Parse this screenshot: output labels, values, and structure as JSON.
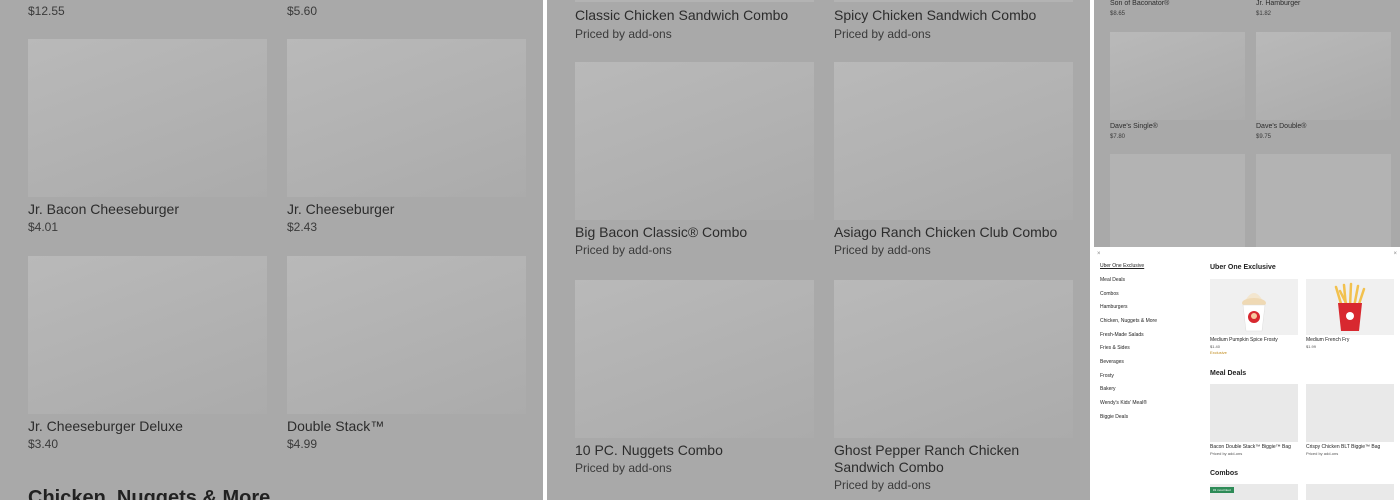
{
  "panel1": {
    "top_prices": [
      "$12.55",
      "$5.60"
    ],
    "items": [
      {
        "name": "Jr. Bacon Cheeseburger",
        "price": "$4.01"
      },
      {
        "name": "Jr. Cheeseburger",
        "price": "$2.43"
      },
      {
        "name": "Jr. Cheeseburger Deluxe",
        "price": "$3.40"
      },
      {
        "name": "Double Stack™",
        "price": "$4.99"
      }
    ],
    "section_title": "Chicken, Nuggets & More"
  },
  "panel2": {
    "top_items": [
      {
        "name": "Classic Chicken Sandwich Combo",
        "price": "Priced by add-ons"
      },
      {
        "name": "Spicy Chicken Sandwich Combo",
        "price": "Priced by add-ons"
      }
    ],
    "items": [
      {
        "name": "Big Bacon Classic® Combo",
        "price": "Priced by add-ons"
      },
      {
        "name": "Asiago Ranch Chicken Club Combo",
        "price": "Priced by add-ons"
      },
      {
        "name": "10 PC. Nuggets Combo",
        "price": "Priced by add-ons"
      },
      {
        "name": "Ghost Pepper Ranch Chicken Sandwich Combo",
        "price": "Priced by add-ons"
      }
    ]
  },
  "panel3": {
    "top_items": [
      {
        "name": "Son of Baconator®",
        "price": "$8.65"
      },
      {
        "name": "Jr. Hamburger",
        "price": "$1.82"
      }
    ],
    "items": [
      {
        "name": "Dave's Single®",
        "price": "$7.80"
      },
      {
        "name": "Dave's Double®",
        "price": "$9.75"
      }
    ]
  },
  "panel4": {
    "nav": [
      "Uber One Exclusive",
      "Meal Deals",
      "Combos",
      "Hamburgers",
      "Chicken, Nuggets & More",
      "Fresh-Made Salads",
      "Fries & Sides",
      "Beverages",
      "Frosty",
      "Bakery",
      "Wendy's Kids' Meal®",
      "Biggie Deals"
    ],
    "sections": {
      "exclusive_title": "Uber One Exclusive",
      "meal_deals_title": "Meal Deals",
      "combos_title": "Combos"
    },
    "exclusive_items": [
      {
        "name": "Medium Pumpkin Spice Frosty",
        "price": "$1.40",
        "tag": "Exclusive"
      },
      {
        "name": "Medium French Fry",
        "price": "$1.99"
      }
    ],
    "meal_deal_items": [
      {
        "name": "Bacon Double Stack™ Biggie™ Bag",
        "price": "Priced by add-ons"
      },
      {
        "name": "Crispy Chicken BLT Biggie™ Bag",
        "price": "Priced by add-ons"
      }
    ],
    "badge": "#1 most liked"
  },
  "colors": {
    "overlay": "#a9a9a9",
    "accent_gold": "#c08a1a",
    "badge_green": "#2e8b57",
    "fries_red": "#d8282f"
  }
}
